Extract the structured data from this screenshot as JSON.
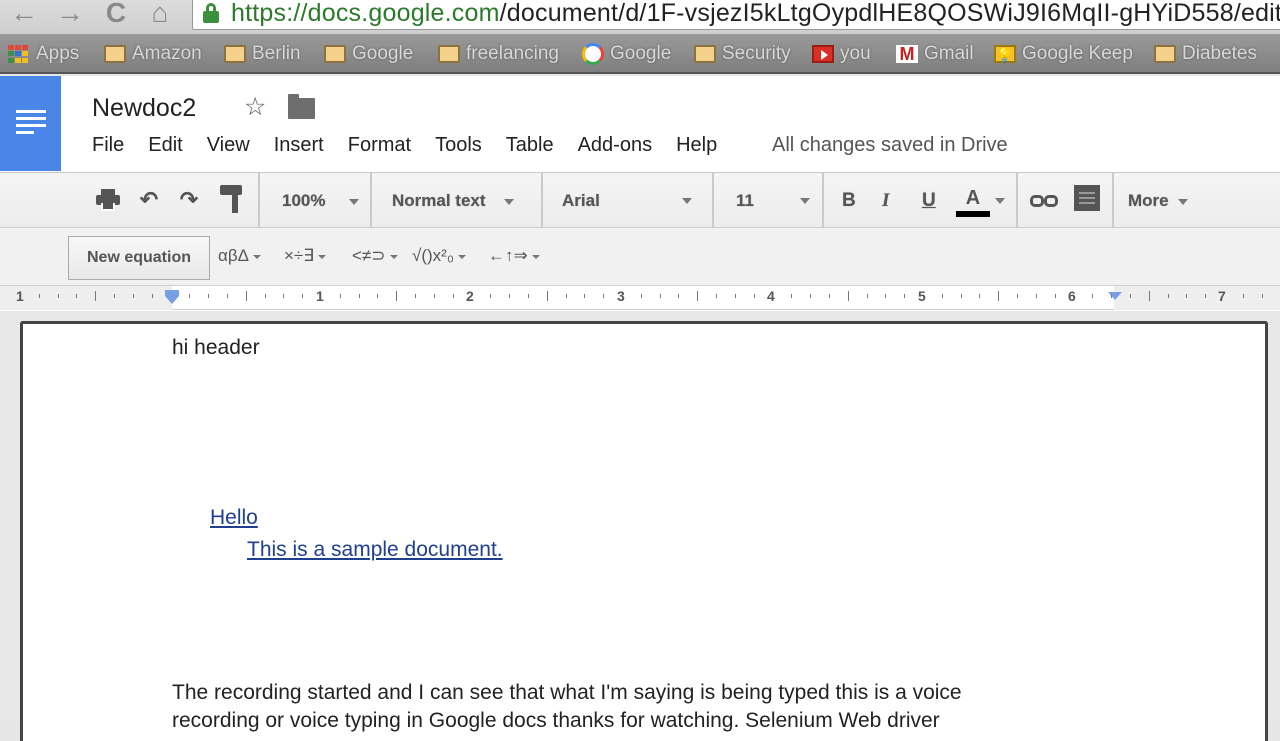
{
  "browser": {
    "nav": {
      "back": "←",
      "forward": "→",
      "reload": "C",
      "home": "⌂"
    },
    "url_host": "https://docs.google.com",
    "url_path": "/document/d/1F-vsjezI5kLtgOypdlHE8QOSWiJ9I6MqII-gHYiD558/edit#",
    "bookmarks": [
      {
        "label": "Apps",
        "icon": "apps-grid-icon"
      },
      {
        "label": "Amazon",
        "icon": "folder-icon"
      },
      {
        "label": "Berlin",
        "icon": "folder-icon"
      },
      {
        "label": "Google",
        "icon": "folder-icon"
      },
      {
        "label": "freelancing",
        "icon": "folder-icon"
      },
      {
        "label": "Google",
        "icon": "google-icon"
      },
      {
        "label": "Security",
        "icon": "folder-icon"
      },
      {
        "label": "you",
        "icon": "youtube-icon"
      },
      {
        "label": "Gmail",
        "icon": "gmail-icon"
      },
      {
        "label": "Google Keep",
        "icon": "keep-icon"
      },
      {
        "label": "Diabetes",
        "icon": "folder-icon"
      }
    ]
  },
  "docs": {
    "title": "Newdoc2",
    "menu": [
      "File",
      "Edit",
      "View",
      "Insert",
      "Format",
      "Tools",
      "Table",
      "Add-ons",
      "Help"
    ],
    "save_status": "All changes saved in Drive",
    "toolbar": {
      "zoom": "100%",
      "style": "Normal text",
      "font": "Arial",
      "size": "11",
      "bold": "B",
      "italic": "I",
      "underline": "U",
      "text_color": "A",
      "more": "More"
    },
    "equation_bar": {
      "new_equation": "New equation",
      "menus": [
        "αβΔ",
        "×÷∃",
        "<≠⊃",
        "√()x²₀",
        "←↑⇒"
      ]
    },
    "ruler": {
      "labels": [
        "1",
        "1",
        "2",
        "3",
        "4",
        "5",
        "6",
        "7"
      ]
    },
    "content": {
      "header": "hi header",
      "link1": "Hello",
      "link2": "This is a sample document.",
      "para_line1": "The recording started and I can see that what I'm saying is being typed this is a voice",
      "para_line2": "recording or voice typing in Google docs thanks for watching. Selenium Web driver"
    }
  },
  "colors": {
    "docs_blue": "#4a86e8",
    "link": "#1f3f8f",
    "secure_green": "#3c8f3c"
  }
}
